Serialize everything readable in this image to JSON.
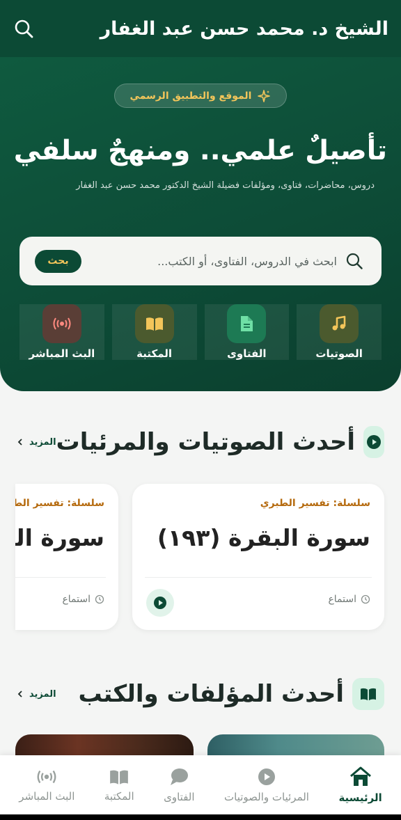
{
  "header": {
    "title": "الشيخ د. محمد حسن عبد الغفار",
    "search_icon": "search-icon"
  },
  "hero": {
    "badge": "الموقع والتطبيق الرسمي",
    "headline": "تأصيلٌ علمي.. ومنهجٌ سلفي",
    "subtitle": "دروس، محاضرات، فتاوى، ومؤلفات فضيلة الشيخ الدكتور محمد حسن عبد الغفار",
    "search_placeholder": "ابحث في الدروس، الفتاوى، أو الكتب...",
    "search_button": "بحث",
    "categories": [
      {
        "label": "الصوتيات",
        "icon": "music-note-icon"
      },
      {
        "label": "الفتاوى",
        "icon": "document-icon"
      },
      {
        "label": "المكتبة",
        "icon": "book-icon"
      },
      {
        "label": "البث المباشر",
        "icon": "broadcast-icon"
      }
    ]
  },
  "audio_section": {
    "title": "أحدث الصوتيات والمرئيات",
    "more": "المزيد",
    "cards": [
      {
        "series": "سلسلة: تفسير الطبري",
        "title": "سورة البقرة (١٩٣)",
        "action": "استماع"
      },
      {
        "series": "سلسلة: تفسير الطبري",
        "title": "سورة البقرة",
        "action": "استماع"
      }
    ]
  },
  "books_section": {
    "title": "أحدث المؤلفات والكتب",
    "more": "المزيد"
  },
  "bottom_nav": {
    "items": [
      {
        "label": "الرئيسية",
        "icon": "home-icon",
        "active": true
      },
      {
        "label": "المرئيات والصوتيات",
        "icon": "play-circle-icon"
      },
      {
        "label": "الفتاوى",
        "icon": "chat-bubble-icon"
      },
      {
        "label": "المكتبة",
        "icon": "book-icon"
      },
      {
        "label": "البث المباشر",
        "icon": "broadcast-icon"
      }
    ]
  },
  "colors": {
    "primary": "#0c4a35",
    "gold": "#f3c55a",
    "series_orange": "#b56a0e"
  }
}
